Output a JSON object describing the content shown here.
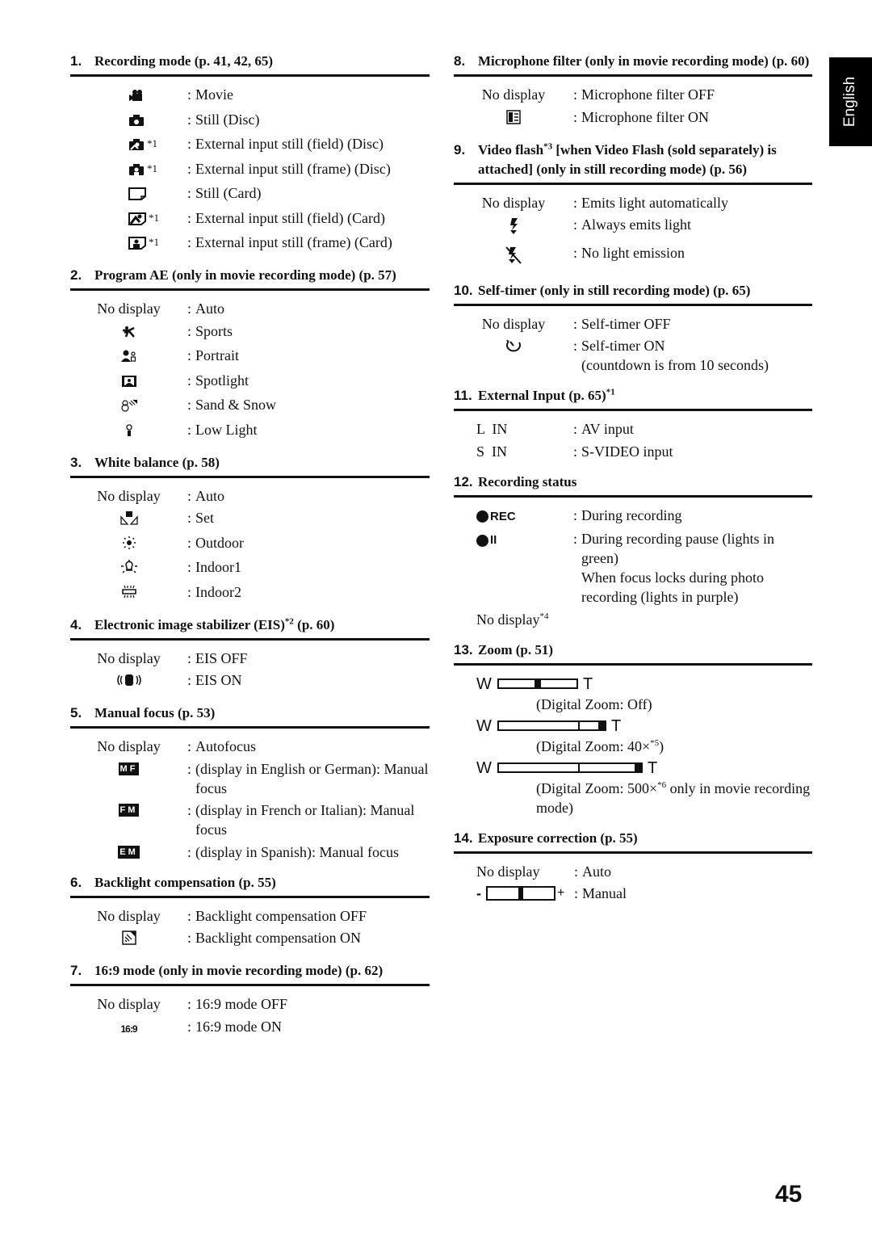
{
  "page": {
    "language_tab": "English",
    "page_number": "45"
  },
  "left": {
    "s1": {
      "num": "1.",
      "title": "Recording mode (p. 41, 42, 65)",
      "rows": [
        {
          "icon": "movie-camera-icon",
          "fn": "",
          "text": "Movie"
        },
        {
          "icon": "still-camera-disc-icon",
          "fn": "",
          "text": "Still (Disc)"
        },
        {
          "icon": "external-input-field-disc-icon",
          "fn": "*1",
          "text": "External input still (field) (Disc)"
        },
        {
          "icon": "external-input-frame-disc-icon",
          "fn": "*1",
          "text": "External input still (frame) (Disc)"
        },
        {
          "icon": "still-card-icon",
          "fn": "",
          "text": "Still (Card)"
        },
        {
          "icon": "external-input-field-card-icon",
          "fn": "*1",
          "text": "External input still (field) (Card)"
        },
        {
          "icon": "external-input-frame-card-icon",
          "fn": "*1",
          "text": "External input still (frame) (Card)"
        }
      ]
    },
    "s2": {
      "num": "2.",
      "title": "Program AE (only in movie recording mode) (p. 57)",
      "no_display": "No display",
      "no_display_text": "Auto",
      "rows": [
        {
          "icon": "sports-icon",
          "text": "Sports"
        },
        {
          "icon": "portrait-icon",
          "text": "Portrait"
        },
        {
          "icon": "spotlight-icon",
          "text": "Spotlight"
        },
        {
          "icon": "sand-snow-icon",
          "text": "Sand & Snow"
        },
        {
          "icon": "low-light-icon",
          "text": "Low Light"
        }
      ]
    },
    "s3": {
      "num": "3.",
      "title": "White balance (p. 58)",
      "no_display": "No display",
      "no_display_text": "Auto",
      "rows": [
        {
          "icon": "white-balance-set-icon",
          "text": "Set"
        },
        {
          "icon": "outdoor-sun-icon",
          "text": "Outdoor"
        },
        {
          "icon": "indoor-bulb-icon",
          "text": "Indoor1"
        },
        {
          "icon": "indoor-fluorescent-icon",
          "text": "Indoor2"
        }
      ]
    },
    "s4": {
      "num": "4.",
      "title": "Electronic image stabilizer (EIS)",
      "title_sup": "*2",
      "title_tail": " (p. 60)",
      "no_display": "No display",
      "no_display_text": "EIS OFF",
      "rows": [
        {
          "icon": "eis-hand-icon",
          "text": "EIS ON"
        }
      ]
    },
    "s5": {
      "num": "5.",
      "title": "Manual focus (p. 53)",
      "no_display": "No display",
      "no_display_text": "Autofocus",
      "rows": [
        {
          "badge": "MF",
          "text": "(display in English or German): Manual focus"
        },
        {
          "badge": "FM",
          "text": "(display in French or Italian): Manual focus"
        },
        {
          "badge": "EM",
          "text": "(display in Spanish): Manual focus"
        }
      ]
    },
    "s6": {
      "num": "6.",
      "title": "Backlight compensation (p. 55)",
      "no_display": "No display",
      "no_display_text": "Backlight compensation OFF",
      "rows": [
        {
          "icon": "backlight-icon",
          "text": "Backlight compensation ON"
        }
      ]
    },
    "s7": {
      "num": "7.",
      "title": "16:9 mode (only in movie recording mode) (p. 62)",
      "no_display": "No display",
      "no_display_text": "16:9 mode OFF",
      "rows": [
        {
          "badge_text": "16:9",
          "text": "16:9 mode ON"
        }
      ]
    }
  },
  "right": {
    "s8": {
      "num": "8.",
      "title": "Microphone filter (only in movie recording mode) (p. 60)",
      "no_display": "No display",
      "no_display_text": "Microphone filter OFF",
      "rows": [
        {
          "icon": "microphone-filter-icon",
          "text": "Microphone filter ON"
        }
      ]
    },
    "s9": {
      "num": "9.",
      "title": "Video flash",
      "title_sup": "*3",
      "title_tail": " [when Video Flash (sold separately) is attached] (only in still recording mode) (p. 56)",
      "no_display": "No display",
      "no_display_text": "Emits light automatically",
      "rows": [
        {
          "icon": "flash-icon",
          "text": "Always emits light"
        },
        {
          "icon": "flash-off-icon",
          "text": "No light emission"
        }
      ]
    },
    "s10": {
      "num": "10.",
      "title": "Self-timer (only in still recording mode) (p. 65)",
      "no_display": "No display",
      "no_display_text": "Self-timer OFF",
      "rows": [
        {
          "icon": "self-timer-icon",
          "text": "Self-timer ON",
          "text2": "(countdown is from 10 seconds)"
        }
      ]
    },
    "s11": {
      "num": "11.",
      "title": "External Input (p. 65)",
      "title_sup": "*1",
      "rows": [
        {
          "key": "L  IN",
          "text": "AV input"
        },
        {
          "key": "S  IN",
          "text": "S-VIDEO input"
        }
      ]
    },
    "s12": {
      "num": "12.",
      "title": "Recording status",
      "rows": [
        {
          "icon_label": "REC",
          "text": "During recording"
        },
        {
          "icon_label": "II",
          "text": "During recording pause (lights in green)",
          "text2": "When focus locks during photo recording (lights in purple)"
        }
      ],
      "no_display": "No display",
      "no_display_sup": "*4"
    },
    "s13": {
      "num": "13.",
      "title": "Zoom (p. 51)",
      "wide_label": "W",
      "tele_label": "T",
      "bars": [
        {
          "zoom_position": 0.5,
          "digital_fraction": 0,
          "caption": "(Digital Zoom: Off)",
          "caption_sup": ""
        },
        {
          "zoom_position": 1.0,
          "digital_fraction": 0.25,
          "caption": "(Digital Zoom: 40×",
          "caption_sup": "*5",
          "caption_tail": ")"
        },
        {
          "zoom_position": 1.0,
          "digital_fraction": 0.4,
          "caption": "(Digital Zoom: 500×",
          "caption_sup": "*6",
          "caption_tail": " only in movie recording mode)"
        }
      ]
    },
    "s14": {
      "num": "14.",
      "title": "Exposure correction (p. 55)",
      "no_display": "No display",
      "no_display_text": "Auto",
      "minus_label": "-",
      "plus_label": "+",
      "manual_text": "Manual",
      "exposure_level": 0.5
    }
  }
}
